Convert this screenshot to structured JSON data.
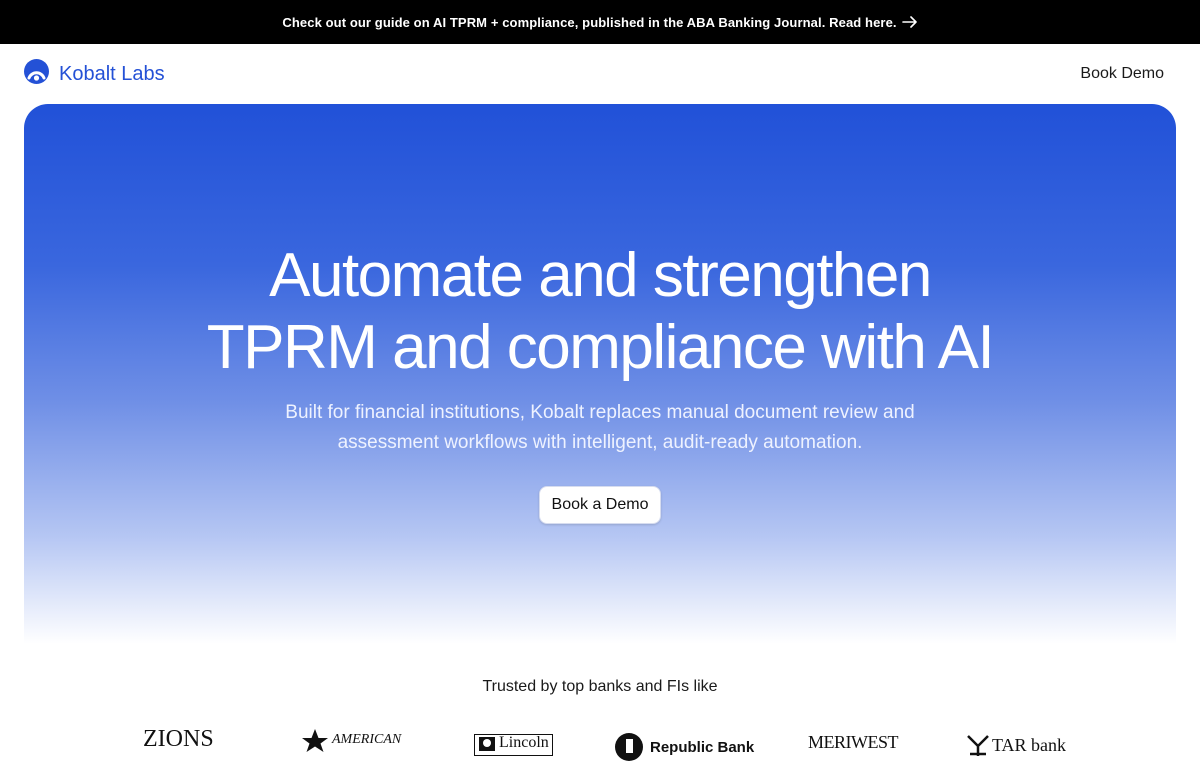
{
  "announcement": {
    "text": "Check out our guide on AI TPRM + compliance, published in the ABA Banking Journal. Read here.",
    "icon": "arrow-right-icon"
  },
  "nav": {
    "brand_name": "Kobalt Labs",
    "brand_icon": "kobalt-logo-icon",
    "link_label": "Book Demo"
  },
  "hero": {
    "headline_line1": "Automate and strengthen",
    "headline_line2": "TPRM and compliance with AI",
    "subtext_line1": "Built for financial institutions, Kobalt replaces manual document review and",
    "subtext_line2": "assessment workflows with intelligent, audit-ready automation.",
    "cta_label": "Book a Demo"
  },
  "trusted": {
    "label": "Trusted by top banks and FIs like",
    "logos": [
      "ZIONS",
      "AMERICAN",
      "Lincoln",
      "Republic Bank",
      "MERIWEST",
      "TAR bank"
    ]
  },
  "colors": {
    "accent": "#2451d6",
    "hero_top": "#2151d8",
    "announcement_bg": "#000000"
  }
}
